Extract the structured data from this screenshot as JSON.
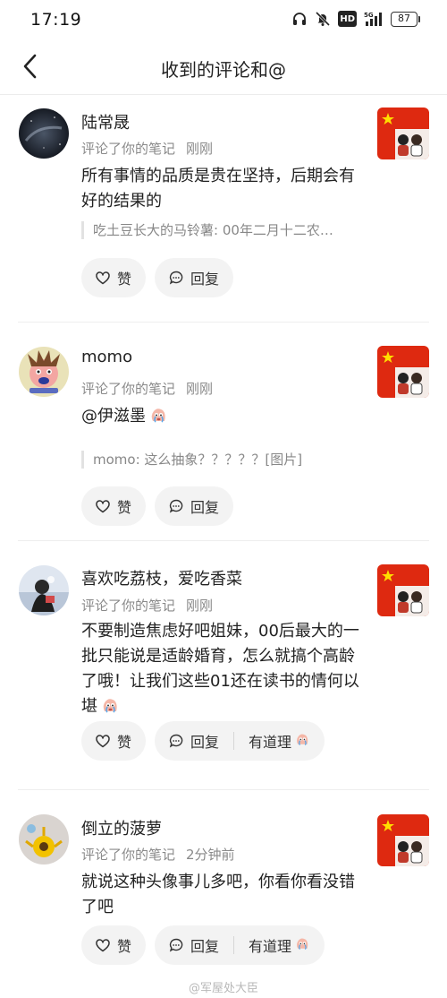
{
  "status_bar": {
    "time": "17:19",
    "network": "5G",
    "hd": "HD",
    "battery": "87"
  },
  "header": {
    "title": "收到的评论和@"
  },
  "comments": [
    {
      "user": "陆常晟",
      "action": "评论了你的笔记",
      "time": "刚刚",
      "text": "所有事情的品质是贵在坚持，后期会有好的结果的",
      "quote": "吃土豆长大的马铃薯: 00年二月十二农…",
      "like_label": "赞",
      "reply_label": "回复"
    },
    {
      "user": "momo",
      "action": "评论了你的笔记",
      "time": "刚刚",
      "text": "@伊滋墨",
      "quote": "momo: 这么抽象？？？？？[图片]",
      "like_label": "赞",
      "reply_label": "回复"
    },
    {
      "user": "喜欢吃荔枝，爱吃香菜",
      "action": "评论了你的笔记",
      "time": "刚刚",
      "text": "不要制造焦虑好吧姐妹，00后最大的一批只能说是适龄婚育，怎么就搞个高龄了哦！让我们这些01还在读书的情何以堪",
      "like_label": "赞",
      "reply_label": "回复",
      "agree_label": "有道理"
    },
    {
      "user": "倒立的菠萝",
      "action": "评论了你的笔记",
      "time": "2分钟前",
      "text": "就说这种头像事儿多吧，你看你看没错了吧",
      "like_label": "赞",
      "reply_label": "回复",
      "agree_label": "有道理"
    }
  ],
  "watermark": "@军屋处大臣",
  "colors": {
    "background": "#ffffff",
    "pill_bg": "#f3f3f3",
    "meta_text": "#8a8a8a",
    "flag_red": "#de2910",
    "flag_star": "#ffde00"
  },
  "icons": [
    "back-arrow-icon",
    "headphones-icon",
    "mute-bell-icon",
    "signal-icon",
    "battery-icon",
    "heart-icon",
    "comment-bubble-icon",
    "crying-emoji-icon"
  ]
}
